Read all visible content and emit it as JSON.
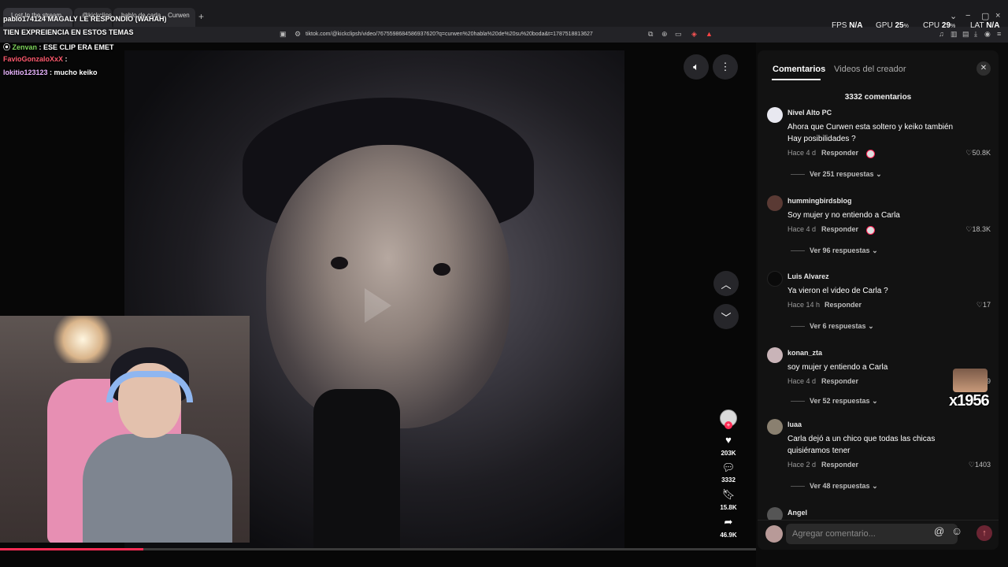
{
  "browser": {
    "tabs": [
      {
        "label": "Lost In the stream"
      },
      {
        "label": "@kickclipsh | TikTok"
      },
      {
        "label": "hablo de carla... Curwen"
      }
    ],
    "url": "tiktok.com/@kickclipsh/video/7675598684586937620?q=curwen%20habla%20de%20su%20boda&t=1787518813627"
  },
  "stats": {
    "fps_label": "FPS",
    "fps_value": "N/A",
    "gpu_label": "GPU",
    "gpu_value": "25",
    "cpu_label": "CPU",
    "cpu_value": "29",
    "lat_label": "LAT",
    "lat_value": "N/A",
    "percent": "%"
  },
  "chat": [
    {
      "user": "pablo174124",
      "text": "MAGALY LE RESPONDIO (WAHAH)",
      "color": "#e9e9e9"
    },
    {
      "user": "",
      "text": "TIEN EXPREIENCIA EN ESTOS TEMAS",
      "color": "#ffffff"
    },
    {
      "user": "Zenvan",
      "text": "ESE CLIP ERA EMET",
      "color": "#7dd35a"
    },
    {
      "user": "FavioGonzaloXxX",
      "text": ":",
      "color": "#ff5a6e"
    },
    {
      "user": "lokitio123123",
      "text": "mucho keiko",
      "color": "#e9b5ff"
    }
  ],
  "video": {
    "side": {
      "likes": "203K",
      "comments": "3332",
      "saves": "15.8K",
      "shares": "46.9K"
    },
    "progress": 0.19
  },
  "panel": {
    "tab_comments": "Comentarios",
    "tab_creator": "Videos del creador",
    "count_label": "3332 comentarios",
    "reply_label": "Responder",
    "input_placeholder": "Agregar comentario...",
    "comments": [
      {
        "user": "Nivel Alto PC",
        "text": "Ahora que Curwen esta soltero y keiko también Hay posibilidades ?",
        "time": "Hace 4 d",
        "likes": "50.8K",
        "replies": "Ver 251 respuestas",
        "avatar": "#e8e8f0"
      },
      {
        "user": "hummingbirdsblog",
        "text": "Soy mujer y no entiendo a Carla",
        "time": "Hace 4 d",
        "likes": "18.3K",
        "replies": "Ver 96 respuestas",
        "avatar": "#5a3a34"
      },
      {
        "user": "Luis Alvarez",
        "text": "Ya vieron el video de Carla ?",
        "time": "Hace 14 h",
        "likes": "17",
        "replies": "Ver 6 respuestas",
        "avatar": "#0a0a0a"
      },
      {
        "user": "konan_zta",
        "text": "soy mujer y entiendo a Carla",
        "time": "Hace 4 d",
        "likes": "9",
        "replies": "Ver 52 respuestas",
        "avatar": "#c9b4b8"
      },
      {
        "user": "luaa",
        "text": "Carla dejó a un chico que todas las chicas quisiéramos tener",
        "time": "Hace 2 d",
        "likes": "1403",
        "replies": "Ver 48 respuestas",
        "avatar": "#8a8070"
      },
      {
        "user": "Angel",
        "text": "",
        "time": "",
        "likes": "",
        "replies": "",
        "avatar": "#555"
      }
    ]
  },
  "sticker_text": "x1956"
}
